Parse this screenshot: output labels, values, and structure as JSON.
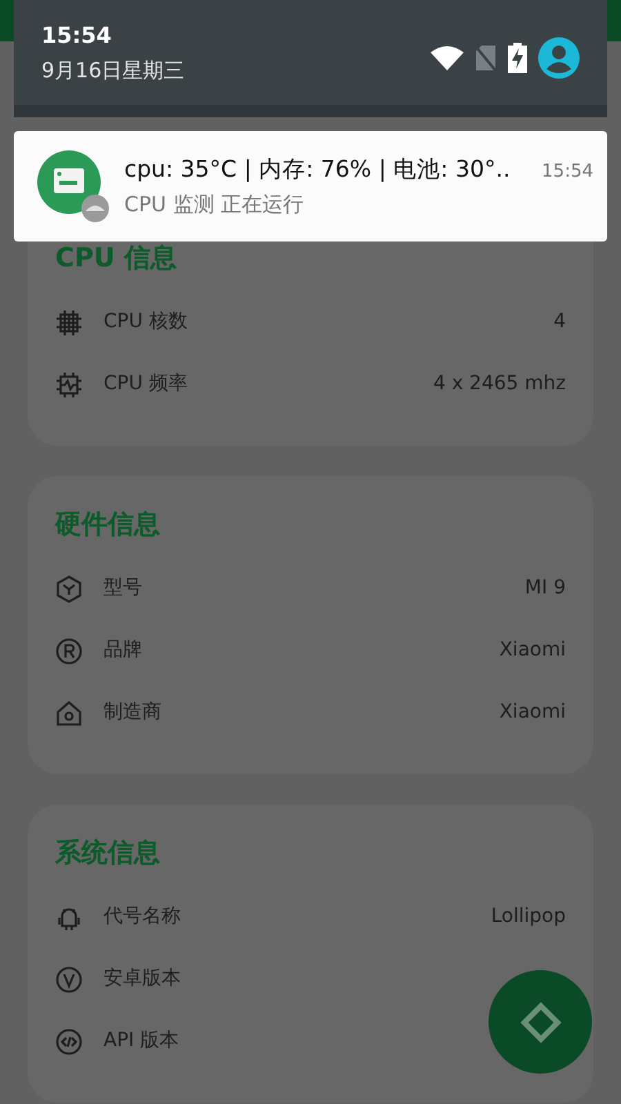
{
  "status_shade": {
    "time": "15:54",
    "date": "9月16日星期三"
  },
  "notification": {
    "title": "cpu: 35°C | 内存: 76% | 电池: 30°..",
    "time": "15:54",
    "subtitle": "CPU 监测 正在运行"
  },
  "sections": [
    {
      "title": "CPU 信息",
      "rows": [
        {
          "label": "CPU 核数",
          "value": "4"
        },
        {
          "label": "CPU 频率",
          "value": "4 x 2465 mhz"
        }
      ]
    },
    {
      "title": "硬件信息",
      "rows": [
        {
          "label": "型号",
          "value": "MI 9"
        },
        {
          "label": "品牌",
          "value": "Xiaomi"
        },
        {
          "label": "制造商",
          "value": "Xiaomi"
        }
      ]
    },
    {
      "title": "系统信息",
      "rows": [
        {
          "label": "代号名称",
          "value": "Lollipop"
        },
        {
          "label": "安卓版本"
        },
        {
          "label": "API 版本"
        }
      ]
    }
  ]
}
